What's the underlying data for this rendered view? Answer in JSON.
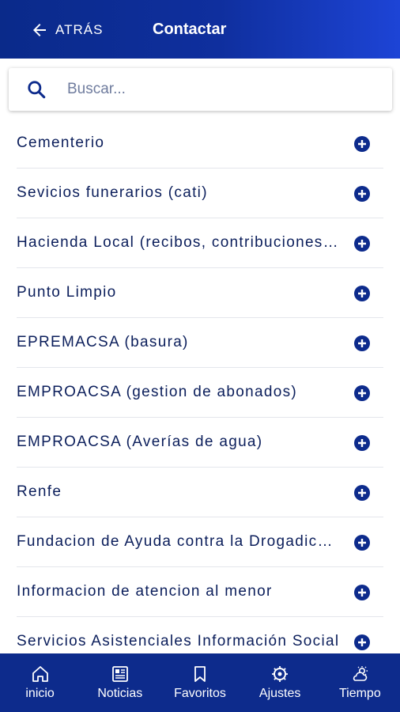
{
  "header": {
    "back_label": "ATRÁS",
    "title": "Contactar"
  },
  "search": {
    "placeholder": "Buscar...",
    "value": ""
  },
  "contacts": [
    {
      "label": "Cementerio"
    },
    {
      "label": "Sevicios funerarios (cati)"
    },
    {
      "label": "Hacienda Local (recibos, contribuciones...)"
    },
    {
      "label": "Punto Limpio"
    },
    {
      "label": "EPREMACSA (basura)"
    },
    {
      "label": "EMPROACSA (gestion de abonados)"
    },
    {
      "label": "EMPROACSA (Averías de agua)"
    },
    {
      "label": "Renfe"
    },
    {
      "label": "Fundacion de Ayuda contra la Drogadicción"
    },
    {
      "label": "Informacion de atencion al menor"
    },
    {
      "label": "Servicios Asistenciales Información Social"
    }
  ],
  "bottom_nav": [
    {
      "label": "inicio",
      "icon": "home-icon"
    },
    {
      "label": "Noticias",
      "icon": "newspaper-icon"
    },
    {
      "label": "Favoritos",
      "icon": "bookmark-icon"
    },
    {
      "label": "Ajustes",
      "icon": "settings-icon"
    },
    {
      "label": "Tiempo",
      "icon": "weather-icon"
    }
  ],
  "colors": {
    "primary": "#0d2b8c",
    "text": "#0b1e5b",
    "accent_gradient_end": "#1d44d6"
  }
}
